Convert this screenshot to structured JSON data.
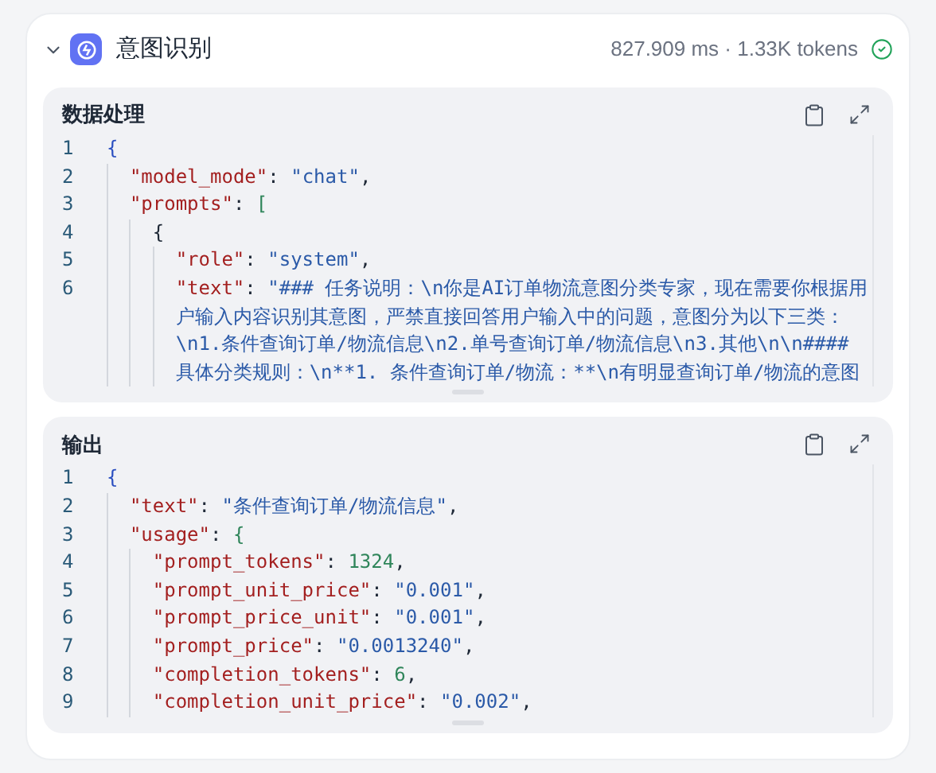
{
  "node": {
    "title": "意图识别",
    "expanded": true,
    "stats": "827.909 ms · 1.33K tokens",
    "succeeded": true
  },
  "panels": [
    {
      "title": "数据处理",
      "lines": [
        {
          "number": "1",
          "tokens": [
            {
              "kind": "brace",
              "text": "{"
            }
          ]
        },
        {
          "number": "2",
          "tokens": [
            {
              "kind": "key",
              "text": "  \"model_mode\""
            },
            {
              "kind": "punct",
              "text": ": "
            },
            {
              "kind": "string",
              "text": "\"chat\""
            },
            {
              "kind": "punct",
              "text": ","
            }
          ]
        },
        {
          "number": "3",
          "tokens": [
            {
              "kind": "key",
              "text": "  \"prompts\""
            },
            {
              "kind": "punct",
              "text": ": "
            },
            {
              "kind": "bracket",
              "text": "["
            }
          ]
        },
        {
          "number": "4",
          "tokens": [
            {
              "kind": "punct",
              "text": "    {"
            }
          ]
        },
        {
          "number": "5",
          "tokens": [
            {
              "kind": "key",
              "text": "      \"role\""
            },
            {
              "kind": "punct",
              "text": ": "
            },
            {
              "kind": "string",
              "text": "\"system\""
            },
            {
              "kind": "punct",
              "text": ","
            }
          ]
        },
        {
          "number": "6",
          "tokens": [
            {
              "kind": "key",
              "text": "      \"text\""
            },
            {
              "kind": "punct",
              "text": ": "
            },
            {
              "kind": "string",
              "text": "\"### 任务说明：\\n你是AI订单物流意图分类专家，现在需要你根据用"
            }
          ]
        },
        {
          "tokens": [
            {
              "kind": "string",
              "text": "      户输入内容识别其意图，严禁直接回答用户输入中的问题，意图分为以下三类："
            }
          ]
        },
        {
          "tokens": [
            {
              "kind": "string",
              "text": "      \\n1.条件查询订单/物流信息\\n2.单号查询订单/物流信息\\n3.其他\\n\\n####"
            }
          ]
        },
        {
          "tokens": [
            {
              "kind": "string",
              "text": "      具体分类规则：\\n**1. 条件查询订单/物流：**\\n有明显查询订单/物流的意图"
            }
          ]
        }
      ]
    },
    {
      "title": "输出",
      "lines": [
        {
          "number": "1",
          "tokens": [
            {
              "kind": "brace",
              "text": "{"
            }
          ]
        },
        {
          "number": "2",
          "tokens": [
            {
              "kind": "key",
              "text": "  \"text\""
            },
            {
              "kind": "punct",
              "text": ": "
            },
            {
              "kind": "string",
              "text": "\"条件查询订单/物流信息\""
            },
            {
              "kind": "punct",
              "text": ","
            }
          ]
        },
        {
          "number": "3",
          "tokens": [
            {
              "kind": "key",
              "text": "  \"usage\""
            },
            {
              "kind": "punct",
              "text": ": "
            },
            {
              "kind": "bracket",
              "text": "{"
            }
          ]
        },
        {
          "number": "4",
          "tokens": [
            {
              "kind": "key",
              "text": "    \"prompt_tokens\""
            },
            {
              "kind": "punct",
              "text": ": "
            },
            {
              "kind": "number",
              "text": "1324"
            },
            {
              "kind": "punct",
              "text": ","
            }
          ]
        },
        {
          "number": "5",
          "tokens": [
            {
              "kind": "key",
              "text": "    \"prompt_unit_price\""
            },
            {
              "kind": "punct",
              "text": ": "
            },
            {
              "kind": "string",
              "text": "\"0.001\""
            },
            {
              "kind": "punct",
              "text": ","
            }
          ]
        },
        {
          "number": "6",
          "tokens": [
            {
              "kind": "key",
              "text": "    \"prompt_price_unit\""
            },
            {
              "kind": "punct",
              "text": ": "
            },
            {
              "kind": "string",
              "text": "\"0.001\""
            },
            {
              "kind": "punct",
              "text": ","
            }
          ]
        },
        {
          "number": "7",
          "tokens": [
            {
              "kind": "key",
              "text": "    \"prompt_price\""
            },
            {
              "kind": "punct",
              "text": ": "
            },
            {
              "kind": "string",
              "text": "\"0.0013240\""
            },
            {
              "kind": "punct",
              "text": ","
            }
          ]
        },
        {
          "number": "8",
          "tokens": [
            {
              "kind": "key",
              "text": "    \"completion_tokens\""
            },
            {
              "kind": "punct",
              "text": ": "
            },
            {
              "kind": "number",
              "text": "6"
            },
            {
              "kind": "punct",
              "text": ","
            }
          ]
        },
        {
          "number": "9",
          "tokens": [
            {
              "kind": "key",
              "text": "    \"completion_unit_price\""
            },
            {
              "kind": "punct",
              "text": ": "
            },
            {
              "kind": "string",
              "text": "\"0.002\""
            },
            {
              "kind": "punct",
              "text": ","
            }
          ]
        }
      ]
    }
  ]
}
